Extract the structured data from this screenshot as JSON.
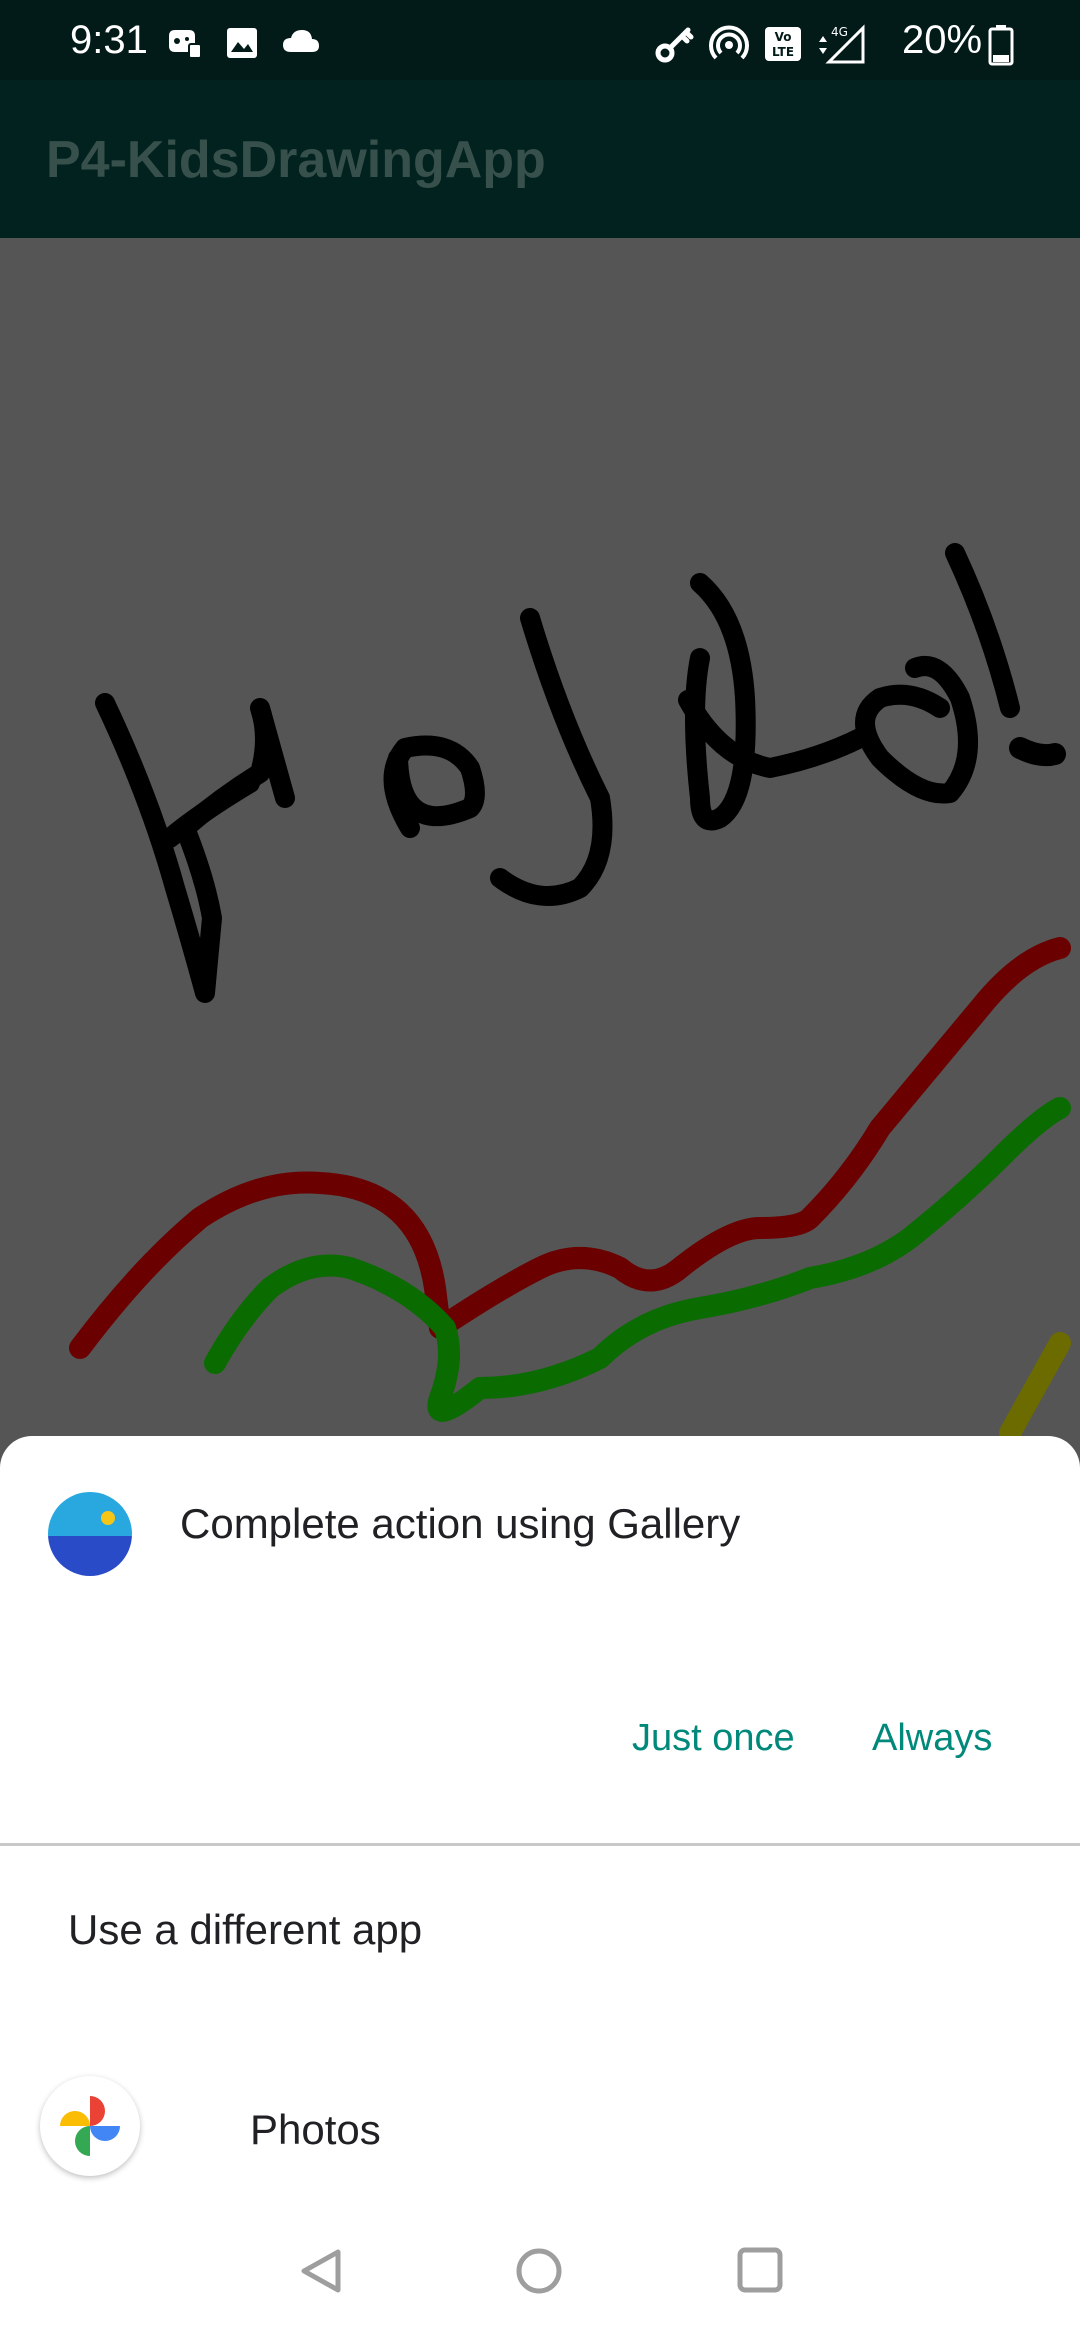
{
  "status_bar": {
    "time": "9:31",
    "battery_percent": "20%",
    "left_icons": [
      "game-controller-icon",
      "image-icon",
      "cloud-icon"
    ],
    "right_icons": [
      "key-icon",
      "hotspot-icon",
      "volte-icon",
      "signal-4g-icon",
      "battery-icon"
    ]
  },
  "app_bar": {
    "title": "P4-KidsDrawingApp"
  },
  "canvas": {
    "background_color": "#555555",
    "stroke_colors": [
      "#000000",
      "#6b0000",
      "#0a6b00",
      "#6b6b00"
    ]
  },
  "dialog": {
    "title": "Complete action using Gallery",
    "app_icon": "gallery-app-icon",
    "just_once_label": "Just once",
    "always_label": "Always",
    "different_app_label": "Use a different app",
    "apps": [
      {
        "name": "Photos",
        "icon": "google-photos-icon"
      }
    ],
    "accent_color": "#00897b"
  },
  "nav_bar": {
    "buttons": [
      "back-icon",
      "home-icon",
      "recents-icon"
    ]
  }
}
